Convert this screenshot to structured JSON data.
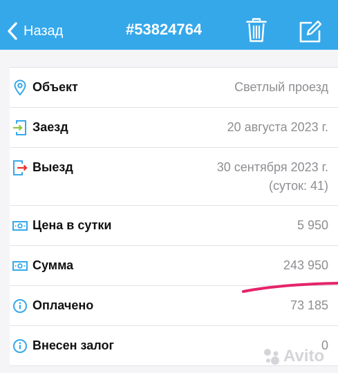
{
  "header": {
    "back_label": "Назад",
    "order_number": "#53824764"
  },
  "details": [
    {
      "label": "Объект",
      "value": "Светлый проезд",
      "icon": "location-pin-icon"
    },
    {
      "label": "Заезд",
      "value": "20 августа 2023 г.",
      "icon": "check-in-icon"
    },
    {
      "label": "Выезд",
      "value": "30 сентября 2023 г.",
      "note": "(суток: 41)",
      "icon": "check-out-icon"
    },
    {
      "label": "Цена в сутки",
      "value": "5 950",
      "icon": "banknote-icon"
    },
    {
      "label": "Сумма",
      "value": "243 950",
      "icon": "banknote-icon"
    },
    {
      "label": "Оплачено",
      "value": "73 185",
      "icon": "info-icon"
    },
    {
      "label": "Внесен залог",
      "value": "0",
      "icon": "info-icon"
    }
  ],
  "watermark": "Avito",
  "colors": {
    "header": "#35a8ea",
    "icon_blue": "#35a8ea",
    "icon_green": "#8dc63f",
    "icon_red": "#e8322b",
    "annotation": "#e5246a"
  }
}
